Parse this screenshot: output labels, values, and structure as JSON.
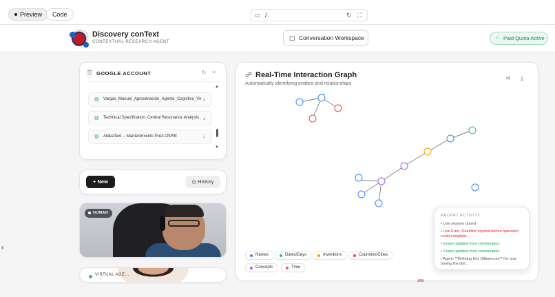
{
  "toolbar": {
    "preview_label": "Preview",
    "code_label": "Code",
    "url_path": "/"
  },
  "header": {
    "brand_title": "Discovery conText",
    "brand_subtitle": "CONTEXTUAL RESEARCH AGENT",
    "workspace_button": "Conversation Workspace",
    "quota_badge": "Paid Quota Active"
  },
  "google_account": {
    "title": "GOOGLE ACCOUNT",
    "files": [
      "Vargas_Manuel_Aproximación_Agente_Cognitivo_Vin...",
      "Technical Specification: Central Resonance Analysis ...",
      "AldeaText -- Mantenimiento Post-CNPIE"
    ]
  },
  "actions": {
    "new_label": "New",
    "history_label": "History"
  },
  "video": {
    "human_tag": "HUMAN",
    "agent_label": "VIRTUAL AGE..."
  },
  "graph": {
    "title": "Real-Time Interaction Graph",
    "subtitle": "Automatically identifying entities and relationships",
    "legend": [
      {
        "label": "Names",
        "color": "#3b82f6"
      },
      {
        "label": "Dates/Days",
        "color": "#22c55e"
      },
      {
        "label": "Inventions",
        "color": "#f59e0b"
      },
      {
        "label": "Countries/Cities",
        "color": "#ef4444"
      },
      {
        "label": "Concepts",
        "color": "#a855f7"
      },
      {
        "label": "Time",
        "color": "#ec4899"
      }
    ]
  },
  "activity": {
    "title": "RECENT ACTIVITY",
    "items": [
      {
        "text": "Live session closed",
        "color": "#555555"
      },
      {
        "text": "Live Error: Deadline expired before operation could complete...",
        "color": "#dc2626"
      },
      {
        "text": "Graph updated from conversation.",
        "color": "#16a34a"
      },
      {
        "text": "Graph updated from conversation.",
        "color": "#16a34a"
      },
      {
        "text": "Agent: **Refining Key Differences** I'm now honing the dist...",
        "color": "#555555"
      }
    ]
  }
}
